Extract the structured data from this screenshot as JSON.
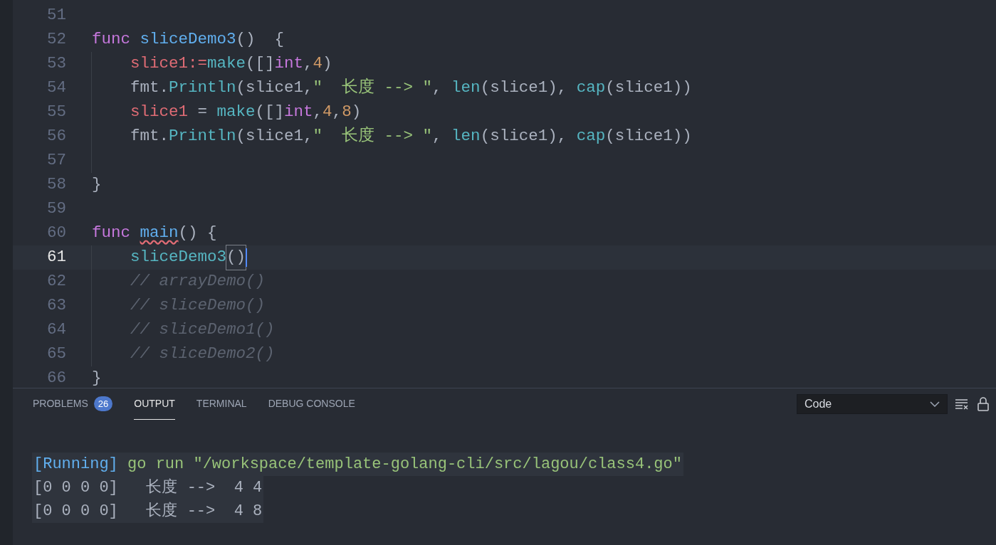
{
  "editor": {
    "lines": [
      {
        "number": "51",
        "current": false,
        "indent_guide": false
      },
      {
        "number": "52",
        "current": false,
        "indent_guide": false,
        "tokens": [
          {
            "kind": "keyword",
            "text": "func "
          },
          {
            "kind": "function",
            "text": "sliceDemo3"
          },
          {
            "kind": "plain",
            "text": "()  {"
          }
        ]
      },
      {
        "number": "53",
        "current": false,
        "indent_guide": true,
        "tokens": [
          {
            "kind": "variable",
            "text": "slice1:="
          },
          {
            "kind": "call",
            "text": "make"
          },
          {
            "kind": "plain",
            "text": "([]"
          },
          {
            "kind": "type",
            "text": "int"
          },
          {
            "kind": "plain",
            "text": ","
          },
          {
            "kind": "number",
            "text": "4"
          },
          {
            "kind": "plain",
            "text": ")"
          }
        ]
      },
      {
        "number": "54",
        "current": false,
        "indent_guide": true,
        "tokens": [
          {
            "kind": "plain",
            "text": "fmt."
          },
          {
            "kind": "call",
            "text": "Println"
          },
          {
            "kind": "plain",
            "text": "(slice1,"
          },
          {
            "kind": "string",
            "text": "\"  长度 --> \""
          },
          {
            "kind": "plain",
            "text": ", "
          },
          {
            "kind": "call",
            "text": "len"
          },
          {
            "kind": "plain",
            "text": "(slice1), "
          },
          {
            "kind": "call",
            "text": "cap"
          },
          {
            "kind": "plain",
            "text": "(slice1))"
          }
        ]
      },
      {
        "number": "55",
        "current": false,
        "indent_guide": true,
        "tokens": [
          {
            "kind": "variable",
            "text": "slice1"
          },
          {
            "kind": "plain",
            "text": " = "
          },
          {
            "kind": "call",
            "text": "make"
          },
          {
            "kind": "plain",
            "text": "([]"
          },
          {
            "kind": "type",
            "text": "int"
          },
          {
            "kind": "plain",
            "text": ","
          },
          {
            "kind": "number",
            "text": "4"
          },
          {
            "kind": "plain",
            "text": ","
          },
          {
            "kind": "number",
            "text": "8"
          },
          {
            "kind": "plain",
            "text": ")"
          }
        ]
      },
      {
        "number": "56",
        "current": false,
        "indent_guide": true,
        "tokens": [
          {
            "kind": "plain",
            "text": "fmt."
          },
          {
            "kind": "call",
            "text": "Println"
          },
          {
            "kind": "plain",
            "text": "(slice1,"
          },
          {
            "kind": "string",
            "text": "\"  长度 --> \""
          },
          {
            "kind": "plain",
            "text": ", "
          },
          {
            "kind": "call",
            "text": "len"
          },
          {
            "kind": "plain",
            "text": "(slice1), "
          },
          {
            "kind": "call",
            "text": "cap"
          },
          {
            "kind": "plain",
            "text": "(slice1))"
          }
        ]
      },
      {
        "number": "57",
        "current": false,
        "indent_guide": true
      },
      {
        "number": "58",
        "current": false,
        "indent_guide": false,
        "tokens": [
          {
            "kind": "plain",
            "text": "}"
          }
        ]
      },
      {
        "number": "59",
        "current": false,
        "indent_guide": false
      },
      {
        "number": "60",
        "current": false,
        "indent_guide": false,
        "tokens": [
          {
            "kind": "keyword",
            "text": "func "
          },
          {
            "kind": "function",
            "text": "main",
            "squiggle": true
          },
          {
            "kind": "plain",
            "text": "() {"
          }
        ]
      },
      {
        "number": "61",
        "current": true,
        "indent_guide": true,
        "tokens": [
          {
            "kind": "call",
            "text": "sliceDemo3"
          },
          {
            "kind": "plain",
            "text": "()",
            "matched": true
          }
        ]
      },
      {
        "number": "62",
        "current": false,
        "indent_guide": true,
        "tokens": [
          {
            "kind": "comment",
            "text": "// arrayDemo()"
          }
        ]
      },
      {
        "number": "63",
        "current": false,
        "indent_guide": true,
        "tokens": [
          {
            "kind": "comment",
            "text": "// sliceDemo()"
          }
        ]
      },
      {
        "number": "64",
        "current": false,
        "indent_guide": true,
        "tokens": [
          {
            "kind": "comment",
            "text": "// sliceDemo1()"
          }
        ]
      },
      {
        "number": "65",
        "current": false,
        "indent_guide": true,
        "tokens": [
          {
            "kind": "comment",
            "text": "// sliceDemo2()"
          }
        ]
      },
      {
        "number": "66",
        "current": false,
        "indent_guide": false,
        "tokens": [
          {
            "kind": "plain",
            "text": "}"
          }
        ]
      }
    ]
  },
  "panel": {
    "tabs": [
      {
        "label": "PROBLEMS",
        "selected": false,
        "badge": "26"
      },
      {
        "label": "OUTPUT",
        "selected": true
      },
      {
        "label": "TERMINAL",
        "selected": false
      },
      {
        "label": "DEBUG CONSOLE",
        "selected": false
      }
    ],
    "channel_select": {
      "value": "Code"
    },
    "output": [
      {
        "tokens": [
          {
            "kind": "tag",
            "text": "[Running]"
          },
          {
            "kind": "string",
            "text": " go run \"/workspace/template-golang-cli/src/lagou/class4.go\""
          }
        ]
      },
      {
        "tokens": [
          {
            "kind": "plain",
            "text": "[0 0 0 0]   长度 -->  4 4"
          }
        ]
      },
      {
        "tokens": [
          {
            "kind": "plain",
            "text": "[0 0 0 0]   长度 -->  4 8"
          }
        ]
      }
    ]
  }
}
